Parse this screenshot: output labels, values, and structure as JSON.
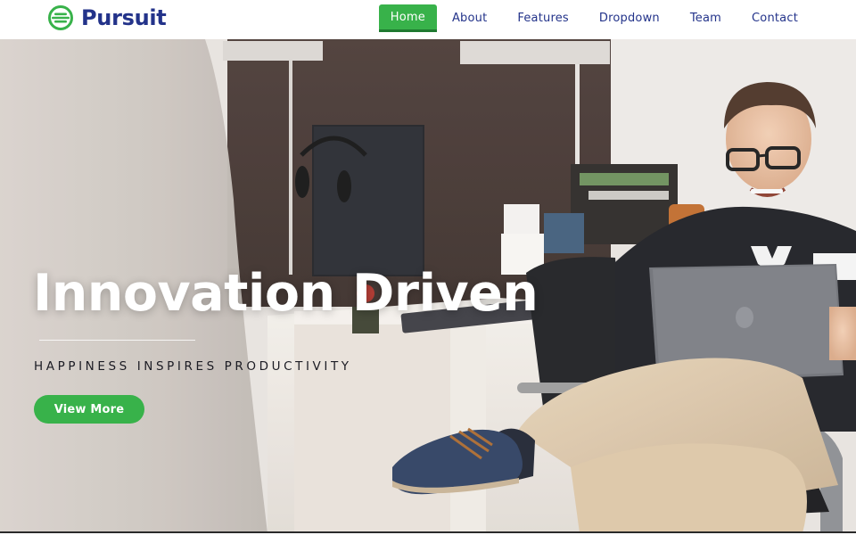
{
  "brand": {
    "name": "Pursuit",
    "logo_icon": "pursuit-logo-icon",
    "color": "#23338a"
  },
  "nav": {
    "items": [
      {
        "label": "Home",
        "active": true
      },
      {
        "label": "About",
        "active": false
      },
      {
        "label": "Features",
        "active": false
      },
      {
        "label": "Dropdown",
        "active": false
      },
      {
        "label": "Team",
        "active": false
      },
      {
        "label": "Contact",
        "active": false
      }
    ]
  },
  "hero": {
    "title": "Innovation Driven",
    "tagline": "HAPPINESS INSPIRES PRODUCTIVITY",
    "cta_label": "View More",
    "background": "photo-man-with-laptop-office"
  },
  "colors": {
    "accent": "#38b24a",
    "accent_dark": "#1f7a30",
    "nav_text": "#23338a"
  }
}
